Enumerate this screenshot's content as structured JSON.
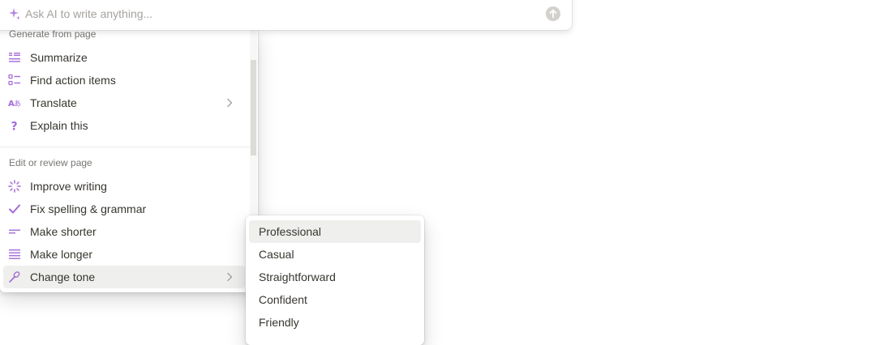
{
  "ai_bar": {
    "placeholder": "Ask AI to write anything...",
    "sparkle_icon": "sparkle-icon",
    "send_icon": "arrow-up-circle-icon"
  },
  "menu": {
    "sections": [
      {
        "label": "Generate from page",
        "items": [
          {
            "label": "Summarize",
            "icon": "summary-lines-icon",
            "submenu": false
          },
          {
            "label": "Find action items",
            "icon": "checklist-icon",
            "submenu": false
          },
          {
            "label": "Translate",
            "icon": "translate-icon",
            "submenu": true
          },
          {
            "label": "Explain this",
            "icon": "question-mark-icon",
            "submenu": false
          }
        ]
      },
      {
        "label": "Edit or review page",
        "items": [
          {
            "label": "Improve writing",
            "icon": "sparkle-burst-icon",
            "submenu": false
          },
          {
            "label": "Fix spelling & grammar",
            "icon": "checkmark-icon",
            "submenu": false
          },
          {
            "label": "Make shorter",
            "icon": "short-lines-icon",
            "submenu": false
          },
          {
            "label": "Make longer",
            "icon": "long-lines-icon",
            "submenu": false
          },
          {
            "label": "Change tone",
            "icon": "microphone-pen-icon",
            "submenu": true,
            "active": true
          }
        ]
      }
    ]
  },
  "tone_submenu": {
    "items": [
      {
        "label": "Professional",
        "active": true
      },
      {
        "label": "Casual"
      },
      {
        "label": "Straightforward"
      },
      {
        "label": "Confident"
      },
      {
        "label": "Friendly"
      }
    ]
  },
  "colors": {
    "accent_purple": "#a36bd8",
    "text": "#37352f",
    "muted": "#787774",
    "hover": "#efefed"
  }
}
